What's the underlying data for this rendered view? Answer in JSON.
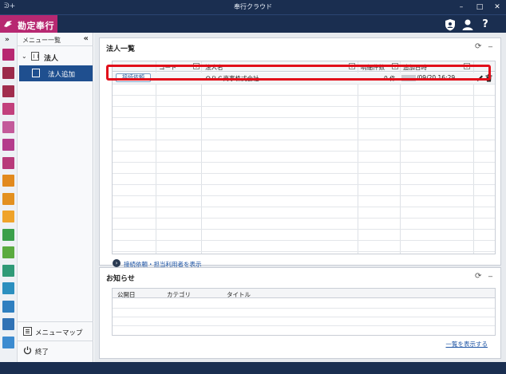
{
  "window": {
    "title": "奉行クラウド",
    "app_icon": "ᕲ+",
    "minimize": "–",
    "maximize": "□",
    "close": "✕"
  },
  "header": {
    "logo_text": "勘定奉行",
    "icons": [
      "shield-user-icon",
      "user-icon",
      "help-icon"
    ],
    "help_glyph": "?"
  },
  "strip": {
    "collapse_label": "»",
    "tile_colors": [
      "#b72871",
      "#9c2a4a",
      "#a12d4d",
      "#c2407c",
      "#c35a9a",
      "#b43c8c",
      "#b83a7a",
      "#e28a1e",
      "#e3901f",
      "#efa32a",
      "#3ba04b",
      "#5aab3f",
      "#2f9a77",
      "#2b8fbf",
      "#2f7fc0",
      "#3072b5",
      "#3c8bd0"
    ]
  },
  "menu": {
    "header_label": "メニュー一覧",
    "header_collapse": "«",
    "category": {
      "chevron": "⌄",
      "label": "法人"
    },
    "selected_item": "法人追加",
    "footer": {
      "menumap": "メニューマップ",
      "exit": "終了"
    }
  },
  "corp_panel": {
    "title": "法人一覧",
    "refresh": "⟳",
    "minimize": "_",
    "columns": [
      "コード",
      "法人名",
      "明細件数",
      "追加日時"
    ],
    "rows": [
      {
        "button": "接続依頼",
        "code": "",
        "name": "ＯＢＣ商事株式会社",
        "count": "0 件",
        "date": "/09/20 16:29"
      }
    ],
    "link": "接続依頼・担当利用者を表示",
    "link_icon": "›"
  },
  "notice_panel": {
    "title": "お知らせ",
    "refresh": "⟳",
    "minimize": "_",
    "columns": [
      "公開日",
      "カテゴリ",
      "タイトル"
    ],
    "link": "一覧を表示する"
  },
  "colors": {
    "titlebar": "#1a2e50",
    "logo": "#b72871",
    "selected": "#1f4f8f",
    "highlight": "#e10e1a",
    "link": "#1f55a5"
  }
}
